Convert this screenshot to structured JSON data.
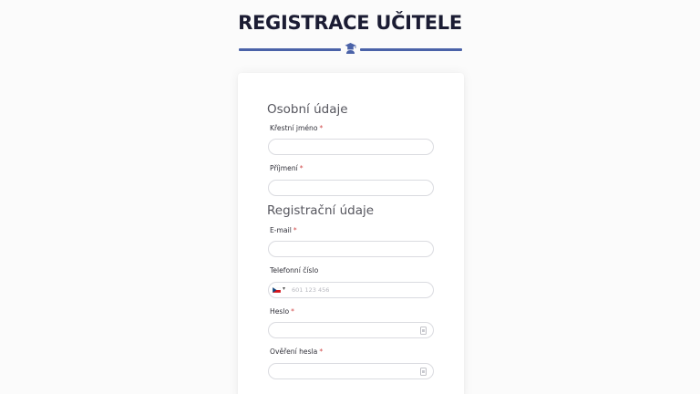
{
  "page": {
    "title": "REGISTRACE UČITELE"
  },
  "sections": {
    "personal": {
      "title": "Osobní údaje",
      "first_name_label": "Křestní jméno",
      "last_name_label": "Příjmení"
    },
    "registration": {
      "title": "Registrační údaje",
      "email_label": "E-mail",
      "phone_label": "Telefonní číslo",
      "phone_placeholder": "601 123 456",
      "password_label": "Heslo",
      "password_confirm_label": "Ověření hesla"
    }
  },
  "required_mark": "*",
  "colors": {
    "accent": "#4a62a8",
    "title": "#1b1c33",
    "required": "#d04646"
  },
  "icons": {
    "divider": "graduation-cap-icon",
    "phone_country": "czech-flag-icon",
    "password_toggle": "eye-icon"
  }
}
